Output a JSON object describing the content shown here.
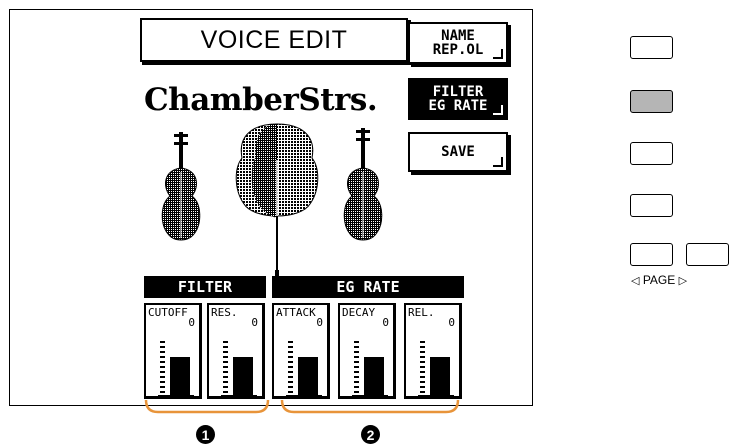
{
  "screen": {
    "title": "VOICE EDIT",
    "voice_name": "ChamberStrs.",
    "soft_buttons": [
      {
        "line1": "NAME",
        "line2": "REP.OL",
        "state": "normal"
      },
      {
        "line1": "FILTER",
        "line2": "EG RATE",
        "state": "selected"
      },
      {
        "line1": "SAVE",
        "line2": "",
        "state": "normal"
      }
    ],
    "instrument_icons": [
      "violin-icon",
      "cello-icon",
      "viola-icon"
    ]
  },
  "groups": {
    "filter_label": "FILTER",
    "eg_label": "EG RATE"
  },
  "params": [
    {
      "label": "CUTOFF",
      "value": "0",
      "level": 0.5
    },
    {
      "label": "RES.",
      "value": "0",
      "level": 0.5
    },
    {
      "label": "ATTACK",
      "value": "0",
      "level": 0.5
    },
    {
      "label": "DECAY",
      "value": "0",
      "level": 0.5
    },
    {
      "label": "REL.",
      "value": "0",
      "level": 0.5
    }
  ],
  "panel": {
    "buttons": [
      {
        "name": "panel-button-1",
        "lit": false
      },
      {
        "name": "panel-button-2",
        "lit": true
      },
      {
        "name": "panel-button-3",
        "lit": false
      },
      {
        "name": "panel-button-4",
        "lit": false
      },
      {
        "name": "page-left-button",
        "lit": false
      },
      {
        "name": "page-right-button",
        "lit": false
      }
    ],
    "page_label": "PAGE"
  },
  "callouts": [
    "1",
    "2"
  ],
  "colors": {
    "lcd_ink": "#000000",
    "lit_button": "#b5b5b5",
    "bracket": "#e8943a"
  }
}
